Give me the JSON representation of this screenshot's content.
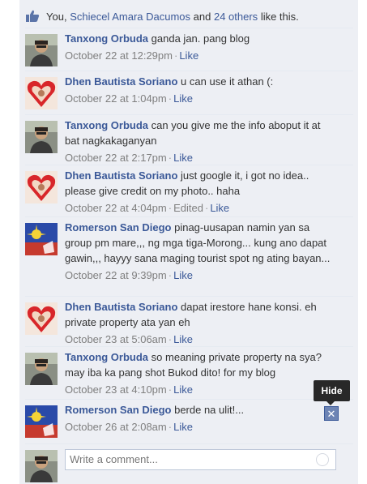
{
  "likes": {
    "prefix": "You, ",
    "user": "Schiecel Amara Dacumos",
    "middle": " and ",
    "others": "24 others",
    "suffix": " like this."
  },
  "like_label": "Like",
  "comments": [
    {
      "author": "Tanxong Orbuda",
      "text": "ganda jan. pang blog",
      "time": "October 22 at 12:29pm",
      "avatar": "photo-man"
    },
    {
      "author": "Dhen Bautista Soriano",
      "text": "u can use it athan (:",
      "time": "October 22 at 1:04pm",
      "avatar": "heart"
    },
    {
      "author": "Tanxong Orbuda",
      "text": "can you give me the info aboput it at bat nagkakaganyan",
      "time": "October 22 at 2:17pm",
      "avatar": "photo-man"
    },
    {
      "author": "Dhen Bautista Soriano",
      "text": "just google it, i got no idea.. please give credit on my photo.. haha",
      "time": "October 22 at 4:04pm",
      "edited": "Edited",
      "avatar": "heart"
    },
    {
      "author": "Romerson San Diego",
      "text": "pinag-uusapan namin yan sa group pm mare,,, ng mga tiga-Morong... kung ano dapat gawin,,, hayyy sana maging tourist spot ng ating bayan...",
      "time": "October 22 at 9:39pm",
      "avatar": "flag"
    },
    {
      "author": "Dhen Bautista Soriano",
      "text": "dapat irestore hane konsi. eh private property ata yan eh",
      "time": "October 23 at 5:06am",
      "avatar": "heart"
    },
    {
      "author": "Tanxong Orbuda",
      "text": "so meaning private property na sya? may iba ka pang shot Bukod dito! for my blog",
      "time": "October 23 at 4:10pm",
      "avatar": "photo-man"
    },
    {
      "author": "Romerson San Diego",
      "text": "berde na ulit!...",
      "time": "October 26 at 2:08am",
      "avatar": "flag"
    }
  ],
  "hide_tooltip": "Hide",
  "hide_icon": "close-x-icon",
  "write_placeholder": "Write a comment...",
  "colors": {
    "link": "#3b5998",
    "panel": "#edeff4",
    "meta": "#7f7f7f"
  }
}
